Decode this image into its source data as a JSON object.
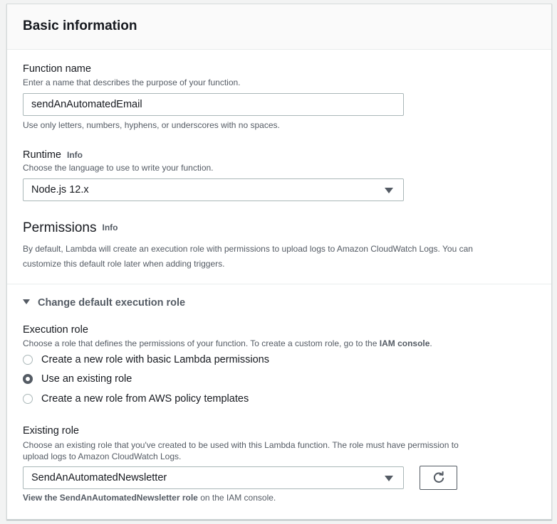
{
  "panel": {
    "title": "Basic information"
  },
  "function_name": {
    "label": "Function name",
    "description": "Enter a name that describes the purpose of your function.",
    "value": "sendAnAutomatedEmail",
    "hint": "Use only letters, numbers, hyphens, or underscores with no spaces."
  },
  "runtime": {
    "label": "Runtime",
    "info": "Info",
    "description": "Choose the language to use to write your function.",
    "selected": "Node.js 12.x"
  },
  "permissions": {
    "title": "Permissions",
    "info": "Info",
    "description_line1": "By default, Lambda will create an execution role with permissions to upload logs to Amazon CloudWatch Logs. You can",
    "description_line2": "customize this default role later when adding triggers."
  },
  "execution_role_section": {
    "toggle_label": "Change default execution role",
    "label": "Execution role",
    "description_prefix": "Choose a role that defines the permissions of your function. To create a custom role, go to the",
    "description_link": "IAM console",
    "description_suffix": ".",
    "options": [
      {
        "label": "Create a new role with basic Lambda permissions",
        "checked": false
      },
      {
        "label": "Use an existing role",
        "checked": true
      },
      {
        "label": "Create a new role from AWS policy templates",
        "checked": false
      }
    ]
  },
  "existing_role": {
    "label": "Existing role",
    "description_line1": "Choose an existing role that you've created to be used with this Lambda function. The role must have permission to",
    "description_line2": "upload logs to Amazon CloudWatch Logs.",
    "selected": "SendAnAutomatedNewsletter",
    "view_link": "View the SendAnAutomatedNewsletter role",
    "view_suffix": "on the IAM console."
  },
  "icons": {
    "refresh": "refresh-icon",
    "dropdown": "caret-down-icon",
    "expand": "triangle-down-icon"
  },
  "colors": {
    "text": "#16191f",
    "secondary": "#545b64",
    "border": "#aab7b8",
    "background": "#f2f3f3"
  }
}
